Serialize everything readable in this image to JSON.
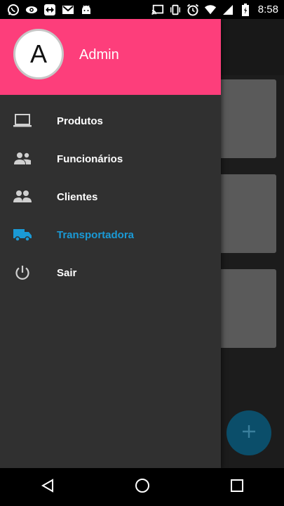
{
  "status_bar": {
    "time": "8:58",
    "left_icons": [
      "whatsapp-icon",
      "eye-icon",
      "teamviewer-icon",
      "gmail-icon",
      "android-icon"
    ],
    "right_icons": [
      "cast-icon",
      "vibrate-icon",
      "alarm-icon",
      "wifi-icon",
      "signal-icon",
      "battery-icon"
    ]
  },
  "drawer": {
    "avatar_letter": "A",
    "user_name": "Admin",
    "header_color": "#fd3e7b",
    "accent_color": "#1a9ad6",
    "items": [
      {
        "label": "Produtos",
        "icon": "laptop-icon",
        "active": false
      },
      {
        "label": "Funcionários",
        "icon": "people-icon",
        "active": false
      },
      {
        "label": "Clientes",
        "icon": "group-icon",
        "active": false
      },
      {
        "label": "Transportadora",
        "icon": "truck-icon",
        "active": true
      },
      {
        "label": "Sair",
        "icon": "power-icon",
        "active": false
      }
    ]
  },
  "fab": {
    "icon": "plus-icon"
  },
  "nav_bar": {
    "buttons": [
      "back-icon",
      "home-icon",
      "recents-icon"
    ]
  }
}
